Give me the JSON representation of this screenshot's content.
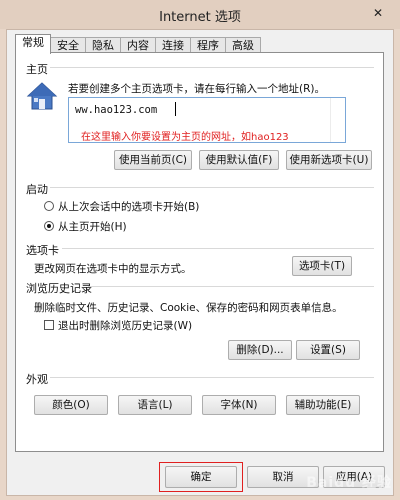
{
  "window": {
    "title": "Internet 选项",
    "close": "✕"
  },
  "tabs": [
    "常规",
    "安全",
    "隐私",
    "内容",
    "连接",
    "程序",
    "高级"
  ],
  "home": {
    "section": "主页",
    "instruction": "若要创建多个主页选项卡，请在每行输入一个地址(R)。",
    "url": "ww.hao123.com",
    "annotation": "在这里输入你要设置为主页的网址，如hao123",
    "buttons": [
      "使用当前页(C)",
      "使用默认值(F)",
      "使用新选项卡(U)"
    ]
  },
  "startup": {
    "section": "启动",
    "options": [
      {
        "label": "从上次会话中的选项卡开始(B)",
        "selected": false
      },
      {
        "label": "从主页开始(H)",
        "selected": true
      }
    ]
  },
  "tabs_section": {
    "section": "选项卡",
    "desc": "更改网页在选项卡中的显示方式。",
    "button": "选项卡(T)"
  },
  "history": {
    "section": "浏览历史记录",
    "desc": "删除临时文件、历史记录、Cookie、保存的密码和网页表单信息。",
    "checkbox": "退出时删除浏览历史记录(W)",
    "buttons": [
      "删除(D)...",
      "设置(S)"
    ]
  },
  "appearance": {
    "section": "外观",
    "buttons": [
      "颜色(O)",
      "语言(L)",
      "字体(N)",
      "辅助功能(E)"
    ]
  },
  "footer": {
    "ok": "确定",
    "cancel": "取消",
    "apply": "应用(A)"
  },
  "watermark": "Baidu 经验"
}
